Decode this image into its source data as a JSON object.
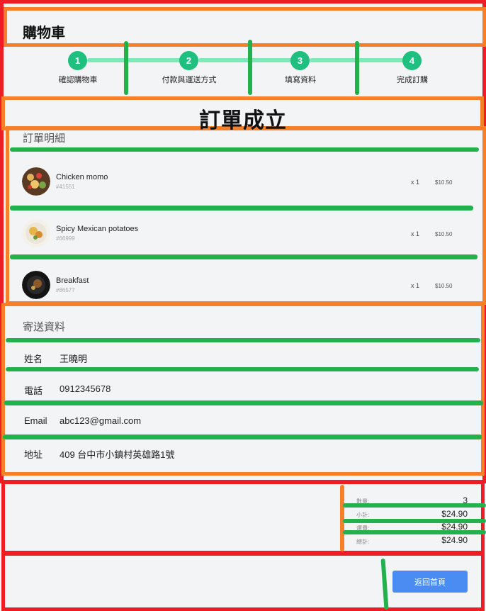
{
  "header": {
    "title": "購物車"
  },
  "stepper": {
    "steps": [
      {
        "number": "1",
        "label": "確認購物車"
      },
      {
        "number": "2",
        "label": "付款與運送方式"
      },
      {
        "number": "3",
        "label": "填寫資料"
      },
      {
        "number": "4",
        "label": "完成訂購"
      }
    ]
  },
  "success_title": "訂單成立",
  "order_details": {
    "heading": "訂單明細",
    "items": [
      {
        "name": "Chicken momo",
        "code": "#41551",
        "qty": "x 1",
        "price": "$10.50"
      },
      {
        "name": "Spicy Mexican potatoes",
        "code": "#66999",
        "qty": "x 1",
        "price": "$10.50"
      },
      {
        "name": "Breakfast",
        "code": "#86577",
        "qty": "x 1",
        "price": "$10.50"
      }
    ]
  },
  "shipping": {
    "heading": "寄送資料",
    "fields": [
      {
        "label": "姓名",
        "value": "王曉明"
      },
      {
        "label": "電話",
        "value": "0912345678"
      },
      {
        "label": "Email",
        "value": "abc123@gmail.com"
      },
      {
        "label": "地址",
        "value": "409 台中市小鎮村英雄路1號"
      }
    ]
  },
  "summary": {
    "rows": [
      {
        "label": "數量:",
        "value": "3"
      },
      {
        "label": "小計:",
        "value": "$24.90"
      },
      {
        "label": "運費:",
        "value": "$24.90"
      },
      {
        "label": "總計:",
        "value": "$24.90"
      }
    ]
  },
  "actions": {
    "home_label": "返回首頁"
  },
  "colors": {
    "accent_green": "#1fbf7f",
    "button_blue": "#4a8cf2"
  }
}
